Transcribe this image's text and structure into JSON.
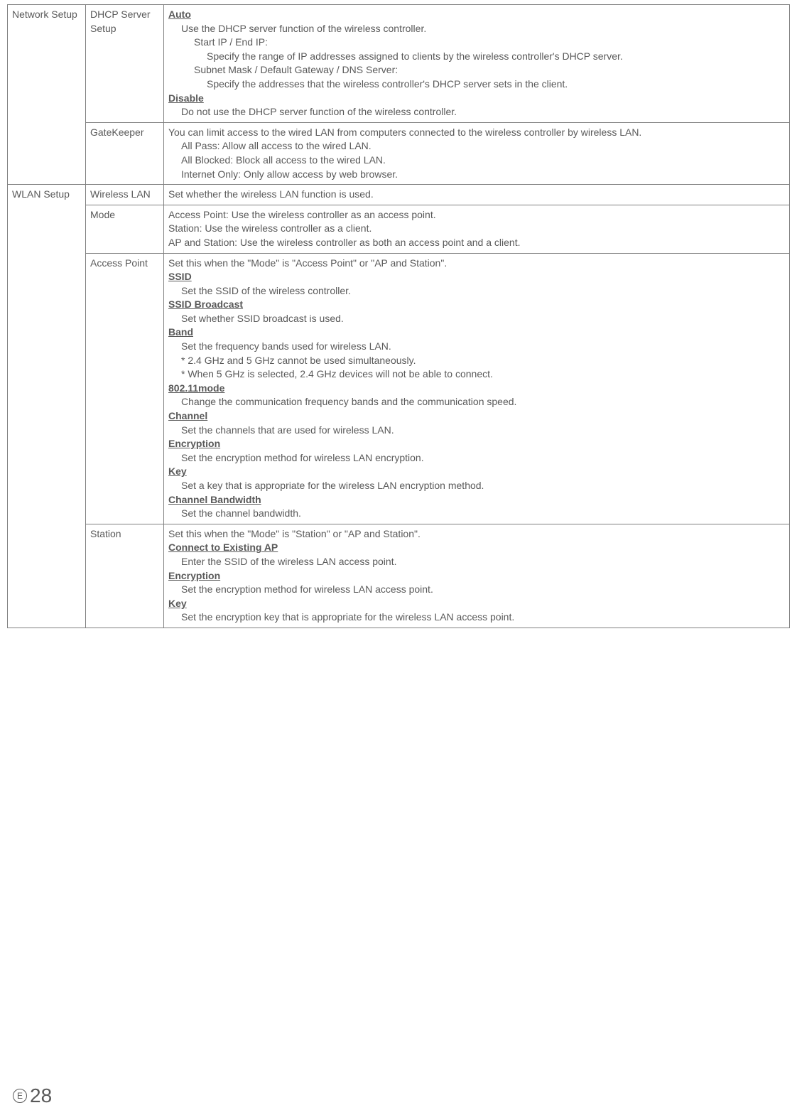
{
  "rows": {
    "network_setup": {
      "label": "Network Setup"
    },
    "dhcp": {
      "label": "DHCP Server Setup",
      "auto_h": "Auto",
      "auto_1": "Use the DHCP server function of the wireless controller.",
      "auto_2": "Start IP / End IP:",
      "auto_3": "Specify the range of IP addresses assigned to clients by the wireless controller's DHCP server.",
      "auto_4": "Subnet Mask / Default Gateway / DNS Server:",
      "auto_5": "Specify the addresses that the wireless controller's DHCP server sets in the client.",
      "disable_h": "Disable",
      "disable_1": "Do not use the DHCP server function of the wireless controller."
    },
    "gatekeeper": {
      "label": "GateKeeper",
      "l1": "You can limit access to the wired LAN from computers connected to the wireless controller by wireless LAN.",
      "l2": "All Pass: Allow all access to the wired LAN.",
      "l3": "All Blocked: Block all access to the wired LAN.",
      "l4": "Internet Only: Only allow access by web browser."
    },
    "wlan_setup": {
      "label": "WLAN Setup"
    },
    "wlan": {
      "label": "Wireless LAN",
      "desc": "Set whether the wireless LAN function is used."
    },
    "mode": {
      "label": "Mode",
      "l1": "Access Point: Use the wireless controller as an access point.",
      "l2": "Station: Use the wireless controller as a client.",
      "l3": "AP and Station: Use the wireless controller as both an access point and a client."
    },
    "ap": {
      "label": "Access Point",
      "l0": "Set this when the \"Mode\" is \"Access Point\" or \"AP and Station\".",
      "ssid_h": "SSID",
      "ssid_1": "Set the SSID of the wireless controller.",
      "sb_h": "SSID Broadcast",
      "sb_1": "Set whether SSID broadcast is used.",
      "band_h": "Band",
      "band_1": "Set the frequency bands used for wireless LAN.",
      "band_2": "*  2.4 GHz and 5 GHz cannot be used simultaneously.",
      "band_3": "*  When 5 GHz is selected, 2.4 GHz devices will not be able to connect.",
      "m802_h": "802.11mode",
      "m802_1": "Change the communication frequency bands and the communication speed.",
      "chan_h": "Channel",
      "chan_1": "Set the channels that are used for wireless LAN.",
      "enc_h": "Encryption",
      "enc_1": "Set the encryption method for wireless LAN encryption.",
      "key_h": "Key",
      "key_1": "Set a key that is appropriate for the wireless LAN encryption method.",
      "cbw_h": "Channel Bandwidth",
      "cbw_1": "Set the channel bandwidth."
    },
    "station": {
      "label": "Station",
      "l0": "Set this when the \"Mode\" is \"Station\" or \"AP and Station\".",
      "cap_h": "Connect to Existing AP",
      "cap_1": "Enter the SSID of the wireless LAN access point.",
      "enc_h": "Encryption",
      "enc_1": "Set the encryption method for wireless LAN access point.",
      "key_h": "Key",
      "key_1": "Set the encryption key that is appropriate for the wireless LAN access point."
    }
  },
  "footer": {
    "lang": "E",
    "page": "28"
  }
}
